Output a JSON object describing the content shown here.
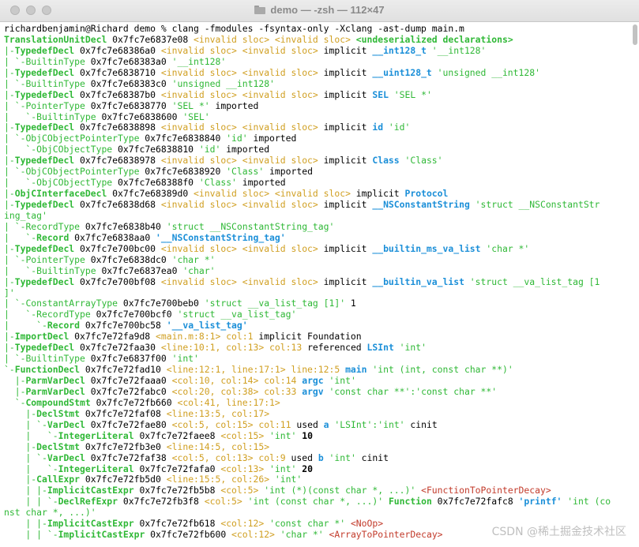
{
  "window": {
    "title": "demo — -zsh — 112×47",
    "buttons": [
      "close",
      "minimize",
      "zoom"
    ]
  },
  "terminal": {
    "prompt": "richardbenjamin@Richard demo % ",
    "command": "clang -fmodules -fsyntax-only -Xclang -ast-dump main.m",
    "lines": [
      [
        [
          "TranslationUnitDecl",
          "g"
        ],
        [
          " 0x7fc7e6837e08 ",
          ""
        ],
        [
          "<invalid sloc>",
          "c"
        ],
        [
          " ",
          ""
        ],
        [
          "<invalid sloc>",
          "c"
        ],
        [
          " ",
          ""
        ],
        [
          "<undeserialized declarations>",
          "g"
        ]
      ],
      [
        [
          "|-",
          "t"
        ],
        [
          "TypedefDecl",
          "g"
        ],
        [
          " 0x7fc7e68386a0 ",
          ""
        ],
        [
          "<invalid sloc>",
          "c"
        ],
        [
          " ",
          ""
        ],
        [
          "<invalid sloc>",
          "c"
        ],
        [
          " implicit ",
          ""
        ],
        [
          "__int128_t",
          "b"
        ],
        [
          " '__int128'",
          "t"
        ]
      ],
      [
        [
          "| `-",
          "t"
        ],
        [
          "BuiltinType",
          "t"
        ],
        [
          " 0x7fc7e68383a0 ",
          ""
        ],
        [
          "'__int128'",
          "t"
        ]
      ],
      [
        [
          "|-",
          "t"
        ],
        [
          "TypedefDecl",
          "g"
        ],
        [
          " 0x7fc7e6838710 ",
          ""
        ],
        [
          "<invalid sloc>",
          "c"
        ],
        [
          " ",
          ""
        ],
        [
          "<invalid sloc>",
          "c"
        ],
        [
          " implicit ",
          ""
        ],
        [
          "__uint128_t",
          "b"
        ],
        [
          " 'unsigned __int128'",
          "t"
        ]
      ],
      [
        [
          "| `-",
          "t"
        ],
        [
          "BuiltinType",
          "t"
        ],
        [
          " 0x7fc7e68383c0 ",
          ""
        ],
        [
          "'unsigned __int128'",
          "t"
        ]
      ],
      [
        [
          "|-",
          "t"
        ],
        [
          "TypedefDecl",
          "g"
        ],
        [
          " 0x7fc7e68387b0 ",
          ""
        ],
        [
          "<invalid sloc>",
          "c"
        ],
        [
          " ",
          ""
        ],
        [
          "<invalid sloc>",
          "c"
        ],
        [
          " implicit ",
          ""
        ],
        [
          "SEL",
          "b"
        ],
        [
          " 'SEL *'",
          "t"
        ]
      ],
      [
        [
          "| `-",
          "t"
        ],
        [
          "PointerType",
          "t"
        ],
        [
          " 0x7fc7e6838770 ",
          ""
        ],
        [
          "'SEL *'",
          "t"
        ],
        [
          " imported",
          ""
        ]
      ],
      [
        [
          "|   `-",
          "t"
        ],
        [
          "BuiltinType",
          "t"
        ],
        [
          " 0x7fc7e6838600 ",
          ""
        ],
        [
          "'SEL'",
          "t"
        ]
      ],
      [
        [
          "|-",
          "t"
        ],
        [
          "TypedefDecl",
          "g"
        ],
        [
          " 0x7fc7e6838898 ",
          ""
        ],
        [
          "<invalid sloc>",
          "c"
        ],
        [
          " ",
          ""
        ],
        [
          "<invalid sloc>",
          "c"
        ],
        [
          " implicit ",
          ""
        ],
        [
          "id",
          "b"
        ],
        [
          " 'id'",
          "t"
        ]
      ],
      [
        [
          "| `-",
          "t"
        ],
        [
          "ObjCObjectPointerType",
          "t"
        ],
        [
          " 0x7fc7e6838840 ",
          ""
        ],
        [
          "'id'",
          "t"
        ],
        [
          " imported",
          ""
        ]
      ],
      [
        [
          "|   `-",
          "t"
        ],
        [
          "ObjCObjectType",
          "t"
        ],
        [
          " 0x7fc7e6838810 ",
          ""
        ],
        [
          "'id'",
          "t"
        ],
        [
          " imported",
          ""
        ]
      ],
      [
        [
          "|-",
          "t"
        ],
        [
          "TypedefDecl",
          "g"
        ],
        [
          " 0x7fc7e6838978 ",
          ""
        ],
        [
          "<invalid sloc>",
          "c"
        ],
        [
          " ",
          ""
        ],
        [
          "<invalid sloc>",
          "c"
        ],
        [
          " implicit ",
          ""
        ],
        [
          "Class",
          "b"
        ],
        [
          " 'Class'",
          "t"
        ]
      ],
      [
        [
          "| `-",
          "t"
        ],
        [
          "ObjCObjectPointerType",
          "t"
        ],
        [
          " 0x7fc7e6838920 ",
          ""
        ],
        [
          "'Class'",
          "t"
        ],
        [
          " imported",
          ""
        ]
      ],
      [
        [
          "|   `-",
          "t"
        ],
        [
          "ObjCObjectType",
          "t"
        ],
        [
          " 0x7fc7e68388f0 ",
          ""
        ],
        [
          "'Class'",
          "t"
        ],
        [
          " imported",
          ""
        ]
      ],
      [
        [
          "|-",
          "t"
        ],
        [
          "ObjCInterfaceDecl",
          "g"
        ],
        [
          " 0x7fc7e68389d0 ",
          ""
        ],
        [
          "<invalid sloc>",
          "c"
        ],
        [
          " ",
          ""
        ],
        [
          "<invalid sloc>",
          "c"
        ],
        [
          " implicit ",
          ""
        ],
        [
          "Protocol",
          "b"
        ]
      ],
      [
        [
          "|-",
          "t"
        ],
        [
          "TypedefDecl",
          "g"
        ],
        [
          " 0x7fc7e6838d68 ",
          ""
        ],
        [
          "<invalid sloc>",
          "c"
        ],
        [
          " ",
          ""
        ],
        [
          "<invalid sloc>",
          "c"
        ],
        [
          " implicit ",
          ""
        ],
        [
          "__NSConstantString",
          "b"
        ],
        [
          " 'struct __NSConstantStr",
          "t"
        ]
      ],
      [
        [
          "ing_tag'",
          "t"
        ]
      ],
      [
        [
          "| `-",
          "t"
        ],
        [
          "RecordType",
          "t"
        ],
        [
          " 0x7fc7e6838b40 ",
          ""
        ],
        [
          "'struct __NSConstantString_tag'",
          "t"
        ]
      ],
      [
        [
          "|   `-",
          "t"
        ],
        [
          "Record",
          "g"
        ],
        [
          " 0x7fc7e6838aa0 ",
          ""
        ],
        [
          "'__NSConstantString_tag'",
          "b"
        ]
      ],
      [
        [
          "|-",
          "t"
        ],
        [
          "TypedefDecl",
          "g"
        ],
        [
          " 0x7fc7e700bc00 ",
          ""
        ],
        [
          "<invalid sloc>",
          "c"
        ],
        [
          " ",
          ""
        ],
        [
          "<invalid sloc>",
          "c"
        ],
        [
          " implicit ",
          ""
        ],
        [
          "__builtin_ms_va_list",
          "b"
        ],
        [
          " 'char *'",
          "t"
        ]
      ],
      [
        [
          "| `-",
          "t"
        ],
        [
          "PointerType",
          "t"
        ],
        [
          " 0x7fc7e6838dc0 ",
          ""
        ],
        [
          "'char *'",
          "t"
        ]
      ],
      [
        [
          "|   `-",
          "t"
        ],
        [
          "BuiltinType",
          "t"
        ],
        [
          " 0x7fc7e6837ea0 ",
          ""
        ],
        [
          "'char'",
          "t"
        ]
      ],
      [
        [
          "|-",
          "t"
        ],
        [
          "TypedefDecl",
          "g"
        ],
        [
          " 0x7fc7e700bf08 ",
          ""
        ],
        [
          "<invalid sloc>",
          "c"
        ],
        [
          " ",
          ""
        ],
        [
          "<invalid sloc>",
          "c"
        ],
        [
          " implicit ",
          ""
        ],
        [
          "__builtin_va_list",
          "b"
        ],
        [
          " 'struct __va_list_tag [1",
          "t"
        ]
      ],
      [
        [
          "]'",
          "t"
        ]
      ],
      [
        [
          "| `-",
          "t"
        ],
        [
          "ConstantArrayType",
          "t"
        ],
        [
          " 0x7fc7e700beb0 ",
          ""
        ],
        [
          "'struct __va_list_tag [1]'",
          "t"
        ],
        [
          " 1",
          ""
        ]
      ],
      [
        [
          "|   `-",
          "t"
        ],
        [
          "RecordType",
          "t"
        ],
        [
          " 0x7fc7e700bcf0 ",
          ""
        ],
        [
          "'struct __va_list_tag'",
          "t"
        ]
      ],
      [
        [
          "|     `-",
          "t"
        ],
        [
          "Record",
          "g"
        ],
        [
          " 0x7fc7e700bc58 ",
          ""
        ],
        [
          "'__va_list_tag'",
          "b"
        ]
      ],
      [
        [
          "|-",
          "t"
        ],
        [
          "ImportDecl",
          "g"
        ],
        [
          " 0x7fc7e72fa9d8 ",
          ""
        ],
        [
          "<main.m:8:1>",
          "c"
        ],
        [
          " ",
          ""
        ],
        [
          "col:1",
          "c"
        ],
        [
          " implicit Foundation",
          ""
        ]
      ],
      [
        [
          "|-",
          "t"
        ],
        [
          "TypedefDecl",
          "g"
        ],
        [
          " 0x7fc7e72faa30 ",
          ""
        ],
        [
          "<line:10:1, col:13>",
          "c"
        ],
        [
          " ",
          ""
        ],
        [
          "col:13",
          "c"
        ],
        [
          " referenced ",
          ""
        ],
        [
          "LSInt",
          "b"
        ],
        [
          " 'int'",
          "t"
        ]
      ],
      [
        [
          "| `-",
          "t"
        ],
        [
          "BuiltinType",
          "t"
        ],
        [
          " 0x7fc7e6837f00 ",
          ""
        ],
        [
          "'int'",
          "t"
        ]
      ],
      [
        [
          "`-",
          "t"
        ],
        [
          "FunctionDecl",
          "g"
        ],
        [
          " 0x7fc7e72fad10 ",
          ""
        ],
        [
          "<line:12:1, line:17:1>",
          "c"
        ],
        [
          " ",
          ""
        ],
        [
          "line:12:5",
          "c"
        ],
        [
          " ",
          ""
        ],
        [
          "main",
          "b"
        ],
        [
          " 'int (int, const char **)'",
          "t"
        ]
      ],
      [
        [
          "  |-",
          "t"
        ],
        [
          "ParmVarDecl",
          "g"
        ],
        [
          " 0x7fc7e72faaa0 ",
          ""
        ],
        [
          "<col:10, col:14>",
          "c"
        ],
        [
          " ",
          ""
        ],
        [
          "col:14",
          "c"
        ],
        [
          " ",
          ""
        ],
        [
          "argc",
          "b"
        ],
        [
          " 'int'",
          "t"
        ]
      ],
      [
        [
          "  |-",
          "t"
        ],
        [
          "ParmVarDecl",
          "g"
        ],
        [
          " 0x7fc7e72fabc0 ",
          ""
        ],
        [
          "<col:20, col:38>",
          "c"
        ],
        [
          " ",
          ""
        ],
        [
          "col:33",
          "c"
        ],
        [
          " ",
          ""
        ],
        [
          "argv",
          "b"
        ],
        [
          " 'const char **':'const char **'",
          "t"
        ]
      ],
      [
        [
          "  `-",
          "t"
        ],
        [
          "CompoundStmt",
          "g"
        ],
        [
          " 0x7fc7e72fb660 ",
          ""
        ],
        [
          "<col:41, line:17:1>",
          "c"
        ]
      ],
      [
        [
          "    |-",
          "t"
        ],
        [
          "DeclStmt",
          "g"
        ],
        [
          " 0x7fc7e72faf08 ",
          ""
        ],
        [
          "<line:13:5, col:17>",
          "c"
        ]
      ],
      [
        [
          "    | `-",
          "t"
        ],
        [
          "VarDecl",
          "g"
        ],
        [
          " 0x7fc7e72fae80 ",
          ""
        ],
        [
          "<col:5, col:15>",
          "c"
        ],
        [
          " ",
          ""
        ],
        [
          "col:11",
          "c"
        ],
        [
          " used ",
          ""
        ],
        [
          "a",
          "b"
        ],
        [
          " 'LSInt':'int'",
          "t"
        ],
        [
          " cinit",
          ""
        ]
      ],
      [
        [
          "    |   `-",
          "t"
        ],
        [
          "IntegerLiteral",
          "g"
        ],
        [
          " 0x7fc7e72faee8 ",
          ""
        ],
        [
          "<col:15>",
          "c"
        ],
        [
          " 'int'",
          "t"
        ],
        [
          " 10",
          "d"
        ]
      ],
      [
        [
          "    |-",
          "t"
        ],
        [
          "DeclStmt",
          "g"
        ],
        [
          " 0x7fc7e72fb3e0 ",
          ""
        ],
        [
          "<line:14:5, col:15>",
          "c"
        ]
      ],
      [
        [
          "    | `-",
          "t"
        ],
        [
          "VarDecl",
          "g"
        ],
        [
          " 0x7fc7e72faf38 ",
          ""
        ],
        [
          "<col:5, col:13>",
          "c"
        ],
        [
          " ",
          ""
        ],
        [
          "col:9",
          "c"
        ],
        [
          " used ",
          ""
        ],
        [
          "b",
          "b"
        ],
        [
          " 'int'",
          "t"
        ],
        [
          " cinit",
          ""
        ]
      ],
      [
        [
          "    |   `-",
          "t"
        ],
        [
          "IntegerLiteral",
          "g"
        ],
        [
          " 0x7fc7e72fafa0 ",
          ""
        ],
        [
          "<col:13>",
          "c"
        ],
        [
          " 'int'",
          "t"
        ],
        [
          " 20",
          "d"
        ]
      ],
      [
        [
          "    |-",
          "t"
        ],
        [
          "CallExpr",
          "g"
        ],
        [
          " 0x7fc7e72fb5d0 ",
          ""
        ],
        [
          "<line:15:5, col:26>",
          "c"
        ],
        [
          " 'int'",
          "t"
        ]
      ],
      [
        [
          "    | |-",
          "t"
        ],
        [
          "ImplicitCastExpr",
          "g"
        ],
        [
          " 0x7fc7e72fb5b8 ",
          ""
        ],
        [
          "<col:5>",
          "c"
        ],
        [
          " 'int (*)(const char *, ...)'",
          "t"
        ],
        [
          " ",
          ""
        ],
        [
          "<FunctionToPointerDecay>",
          "o"
        ]
      ],
      [
        [
          "    | | `-",
          "t"
        ],
        [
          "DeclRefExpr",
          "g"
        ],
        [
          " 0x7fc7e72fb3f8 ",
          ""
        ],
        [
          "<col:5>",
          "c"
        ],
        [
          " 'int (const char *, ...)'",
          "t"
        ],
        [
          " ",
          ""
        ],
        [
          "Function",
          "g"
        ],
        [
          " 0x7fc7e72fafc8 ",
          ""
        ],
        [
          "'printf'",
          "b"
        ],
        [
          " 'int (co",
          "t"
        ]
      ],
      [
        [
          "nst char *, ...)'",
          "t"
        ]
      ],
      [
        [
          "    | |-",
          "t"
        ],
        [
          "ImplicitCastExpr",
          "g"
        ],
        [
          " 0x7fc7e72fb618 ",
          ""
        ],
        [
          "<col:12>",
          "c"
        ],
        [
          " 'const char *'",
          "t"
        ],
        [
          " ",
          ""
        ],
        [
          "<NoOp>",
          "o"
        ]
      ],
      [
        [
          "    | | `-",
          "t"
        ],
        [
          "ImplicitCastExpr",
          "g"
        ],
        [
          " 0x7fc7e72fb600 ",
          ""
        ],
        [
          "<col:12>",
          "c"
        ],
        [
          " 'char *'",
          "t"
        ],
        [
          " ",
          ""
        ],
        [
          "<ArrayToPointerDecay>",
          "o"
        ]
      ]
    ]
  },
  "watermark": "CSDN @稀土掘金技术社区"
}
